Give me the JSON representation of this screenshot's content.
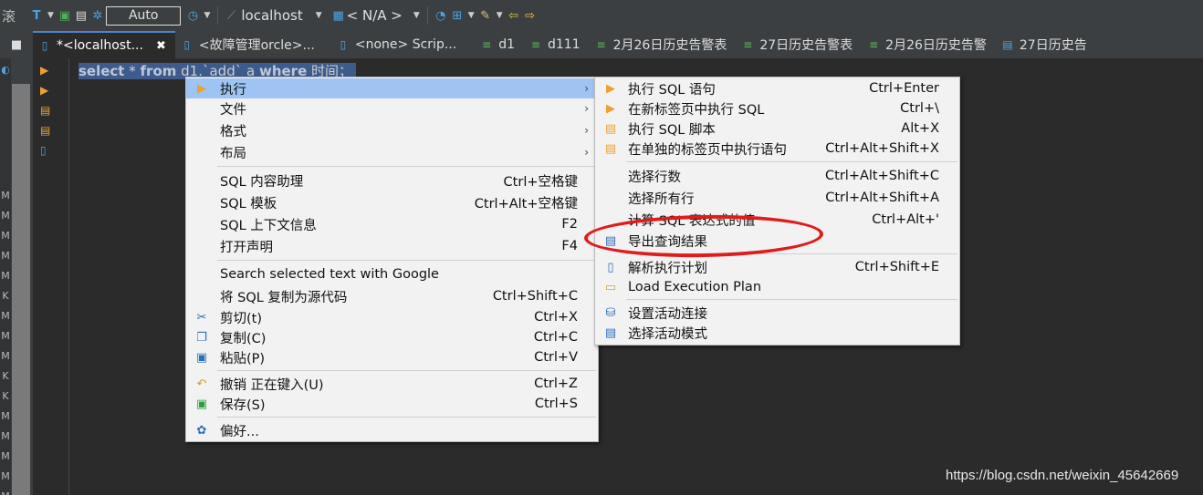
{
  "toolbar": {
    "left_glyph": "滚",
    "auto_label": "Auto",
    "connection": "localhost",
    "database": "< N/A >"
  },
  "gutter": {
    "top_glyph": "■",
    "marks": [
      "M",
      "M",
      "M",
      "M",
      "M",
      "K",
      "M",
      "M",
      "M",
      "K",
      "K",
      "M",
      "M",
      "M",
      "M",
      "M"
    ]
  },
  "tabs": [
    {
      "label": "*<localhost...",
      "active": true
    },
    {
      "label": "<故障管理orcle>..."
    },
    {
      "label": "<none> Scrip..."
    },
    {
      "label": "d1"
    },
    {
      "label": "d111"
    },
    {
      "label": "2月26日历史告警表"
    },
    {
      "label": "27日历史告警表"
    },
    {
      "label": "2月26日历史告警"
    },
    {
      "label": "27日历史告"
    }
  ],
  "editor": {
    "sql_kw_select": "select",
    "sql_mid1": " * ",
    "sql_kw_from": "from",
    "sql_mid2": " d1.`add` a ",
    "sql_kw_where": "where",
    "sql_tail": " 时间；"
  },
  "main_menu": {
    "items": [
      {
        "label": "执行",
        "arrow": "›"
      },
      {
        "label": "文件",
        "arrow": "›"
      },
      {
        "label": "格式",
        "arrow": "›"
      },
      {
        "label": "布局",
        "arrow": "›"
      },
      {
        "label": "SQL 内容助理",
        "shortcut": "Ctrl+空格键"
      },
      {
        "label": "SQL 模板",
        "shortcut": "Ctrl+Alt+空格键"
      },
      {
        "label": "SQL 上下文信息",
        "shortcut": "F2"
      },
      {
        "label": "打开声明",
        "shortcut": "F4"
      },
      {
        "label": "Search selected text with Google"
      },
      {
        "label": "将 SQL 复制为源代码",
        "shortcut": "Ctrl+Shift+C"
      },
      {
        "label": "剪切(t)",
        "shortcut": "Ctrl+X"
      },
      {
        "label": "复制(C)",
        "shortcut": "Ctrl+C"
      },
      {
        "label": "粘贴(P)",
        "shortcut": "Ctrl+V"
      },
      {
        "label": "撤销 正在键入(U)",
        "shortcut": "Ctrl+Z"
      },
      {
        "label": "保存(S)",
        "shortcut": "Ctrl+S"
      },
      {
        "label": "偏好..."
      }
    ]
  },
  "sub_menu": {
    "items": [
      {
        "label": "执行 SQL 语句",
        "shortcut": "Ctrl+Enter"
      },
      {
        "label": "在新标签页中执行 SQL",
        "shortcut": "Ctrl+\\"
      },
      {
        "label": "执行 SQL 脚本",
        "shortcut": "Alt+X"
      },
      {
        "label": "在单独的标签页中执行语句",
        "shortcut": "Ctrl+Alt+Shift+X"
      },
      {
        "label": "选择行数",
        "shortcut": "Ctrl+Alt+Shift+C"
      },
      {
        "label": "选择所有行",
        "shortcut": "Ctrl+Alt+Shift+A"
      },
      {
        "label": "计算 SQL 表达式的值",
        "shortcut": "Ctrl+Alt+'"
      },
      {
        "label": "导出查询结果"
      },
      {
        "label": "解析执行计划",
        "shortcut": "Ctrl+Shift+E"
      },
      {
        "label": "Load Execution Plan"
      },
      {
        "label": "设置活动连接"
      },
      {
        "label": "选择活动模式"
      }
    ]
  },
  "watermark": "https://blog.csdn.net/weixin_45642669",
  "colors": {
    "highlight": "#9dc4f2",
    "annotation_red": "#e01b1b",
    "menu_bg": "#f2f2f2"
  }
}
